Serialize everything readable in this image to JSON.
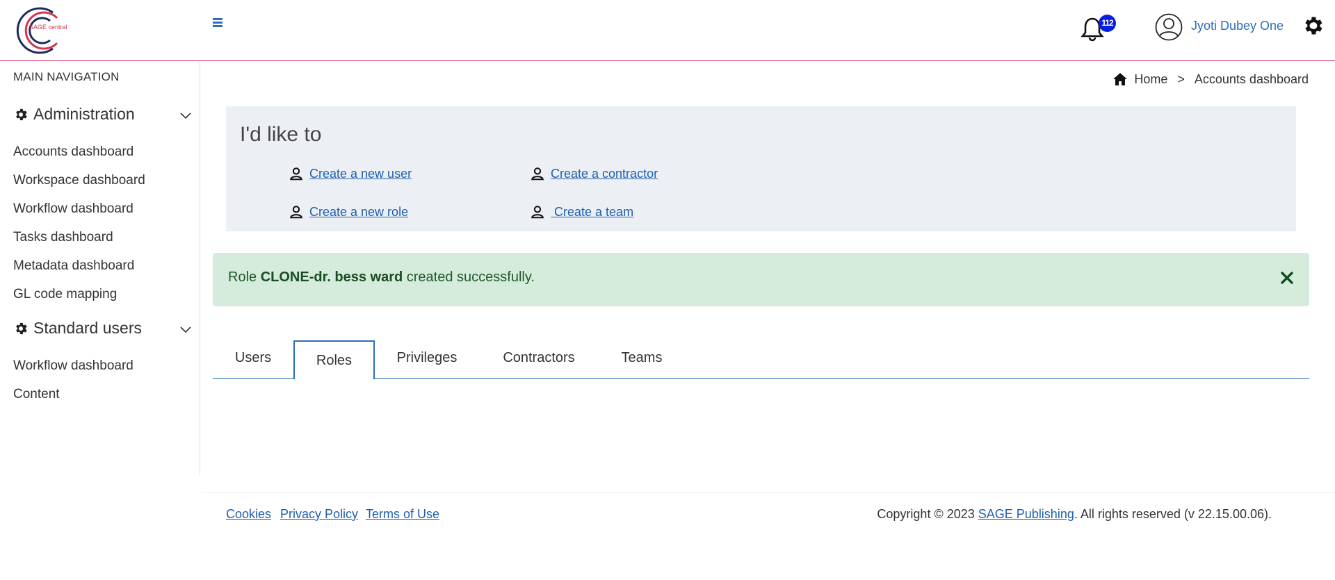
{
  "header": {
    "logo_text": "SAGE central",
    "notification_count": "112",
    "user_name": "Jyoti Dubey One"
  },
  "sidebar": {
    "heading": "MAIN NAVIGATION",
    "groups": [
      {
        "label": "Administration",
        "items": [
          {
            "label": "Accounts dashboard"
          },
          {
            "label": "Workspace dashboard"
          },
          {
            "label": "Workflow dashboard"
          },
          {
            "label": "Tasks dashboard"
          },
          {
            "label": "Metadata dashboard"
          },
          {
            "label": "GL code mapping"
          }
        ]
      },
      {
        "label": "Standard users",
        "items": [
          {
            "label": "Workflow dashboard"
          },
          {
            "label": "Content"
          }
        ]
      }
    ]
  },
  "breadcrumb": {
    "home": "Home",
    "separator": ">",
    "current": "Accounts dashboard"
  },
  "panel": {
    "title": "I'd like to",
    "actions": [
      {
        "label": "Create a new user"
      },
      {
        "label": "Create a contractor"
      },
      {
        "label": "Create a new role"
      },
      {
        "label": " Create a team"
      }
    ]
  },
  "alert": {
    "prefix": "Role ",
    "role_name": "CLONE-dr. bess ward",
    "suffix": " created successfully."
  },
  "tabs": [
    {
      "label": "Users",
      "active": false
    },
    {
      "label": "Roles",
      "active": true
    },
    {
      "label": "Privileges",
      "active": false
    },
    {
      "label": "Contractors",
      "active": false
    },
    {
      "label": "Teams",
      "active": false
    }
  ],
  "footer": {
    "links": [
      "Cookies",
      "Privacy Policy",
      "Terms of Use"
    ],
    "copyright_prefix": "Copyright © 2023 ",
    "publisher": "SAGE Publishing",
    "copyright_suffix": ". All rights reserved (v 22.15.00.06)."
  },
  "colors": {
    "accent": "#2a6ebb",
    "brand_red": "#d6334e",
    "brand_navy": "#1f2a5c",
    "alert_bg": "#d5ebdc",
    "panel_bg": "#eceff4",
    "badge": "#0a1ee0"
  }
}
